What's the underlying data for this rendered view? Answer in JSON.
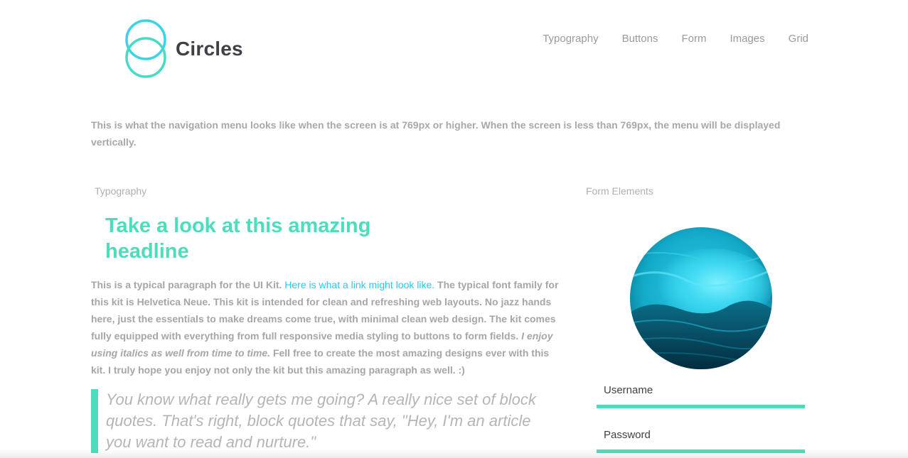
{
  "header": {
    "brand": "Circles",
    "logo_icon": "interlocking-circles-logo-icon",
    "nav": [
      "Typography",
      "Buttons",
      "Form",
      "Images",
      "Grid"
    ]
  },
  "nav_note": "This is what the navigation menu looks like when the screen is at 769px or higher. When the screen is less than 769px, the menu will be displayed vertically.",
  "typography": {
    "section_label": "Typography",
    "headline": "Take a look at this amazing headline",
    "paragraph": {
      "part1": "This is a typical paragraph for the UI Kit. ",
      "link": "Here is what a link might look like.",
      "part2": " The typical font family for this kit is Helvetica Neue. This kit is intended for clean and refreshing web layouts. No jazz hands here, just the essentials to make dreams come true, with minimal clean web design. The kit comes fully equipped with everything from full responsive media styling to buttons to form fields. ",
      "italic": "I enjoy using italics as well from time to time.",
      "part3": " Fell free to create the most amazing designs ever with this kit. I truly hope you enjoy not only the kit but this amazing paragraph as well. :)"
    },
    "blockquote": "You know what really gets me going? A really nice set of block quotes. That's right, block quotes that say, \"Hey, I'm an article you want to read and nurture.\""
  },
  "form": {
    "section_label": "Form Elements",
    "image_icon": "ocean-wave-image",
    "username_label": "Username",
    "password_label": "Password"
  },
  "colors": {
    "accent_green": "#4ddcbc",
    "accent_cyan": "#30c6e6",
    "text_dark": "#3f3f46",
    "text_muted": "#a6a6a6"
  }
}
